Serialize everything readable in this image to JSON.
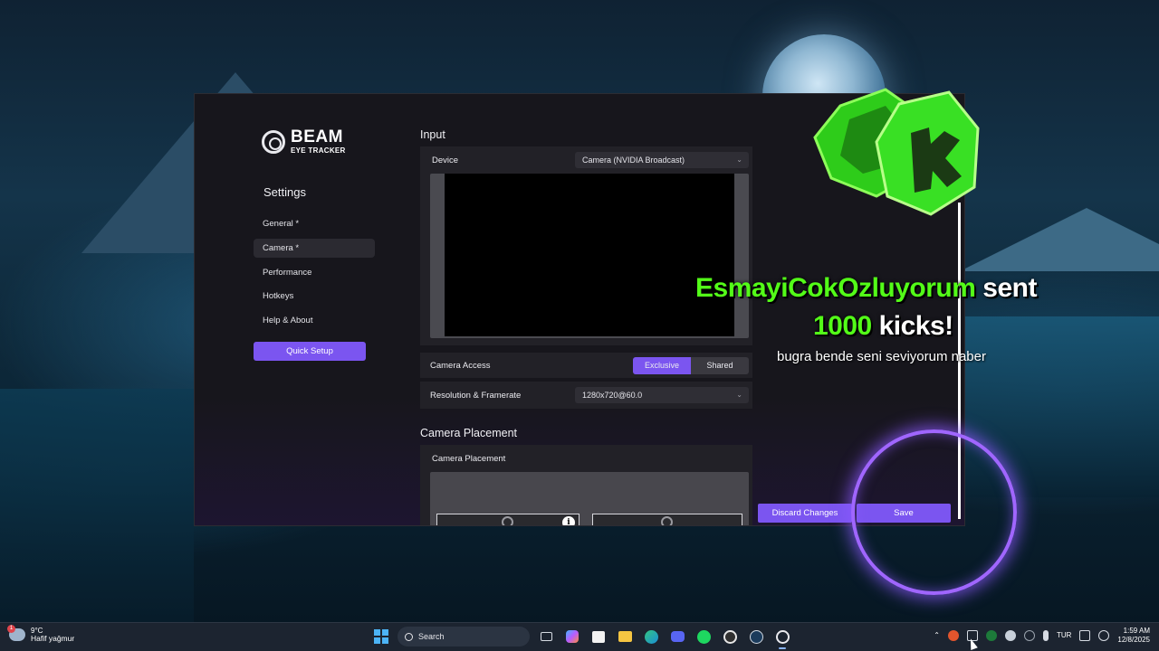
{
  "app": {
    "logo_title": "BEAM",
    "logo_subtitle": "EYE TRACKER",
    "sidebar_title": "Settings",
    "nav": [
      {
        "label": "General *"
      },
      {
        "label": "Camera *"
      },
      {
        "label": "Performance"
      },
      {
        "label": "Hotkeys"
      },
      {
        "label": "Help & About"
      }
    ],
    "quick_setup_label": "Quick Setup",
    "input_section": {
      "title": "Input",
      "device_label": "Device",
      "device_value": "Camera (NVIDIA Broadcast)",
      "camera_access_label": "Camera Access",
      "camera_access_options": [
        "Exclusive",
        "Shared"
      ],
      "camera_access_selected": "Exclusive",
      "resolution_label": "Resolution & Framerate",
      "resolution_value": "1280x720@60.0"
    },
    "placement_section": {
      "title": "Camera Placement",
      "panel_label": "Camera Placement",
      "info_glyph": "i"
    },
    "discard_label": "Discard Changes",
    "save_label": "Save",
    "accent_color": "#7b55f0"
  },
  "overlay": {
    "username": "EsmayiCokOzluyorum",
    "sent_text": "sent",
    "amount": "1000",
    "kicks_text": "kicks!",
    "message": "bugra bende seni seviyorum naber",
    "highlight_color": "#53fc18",
    "gem_icon": "kick-gem-icon"
  },
  "taskbar": {
    "weather_badge": "1",
    "weather_temp": "9°C",
    "weather_desc": "Hafif yağmur",
    "search_label": "Search",
    "language": "TUR",
    "time": "1:59 AM",
    "date": "12/8/2025"
  }
}
